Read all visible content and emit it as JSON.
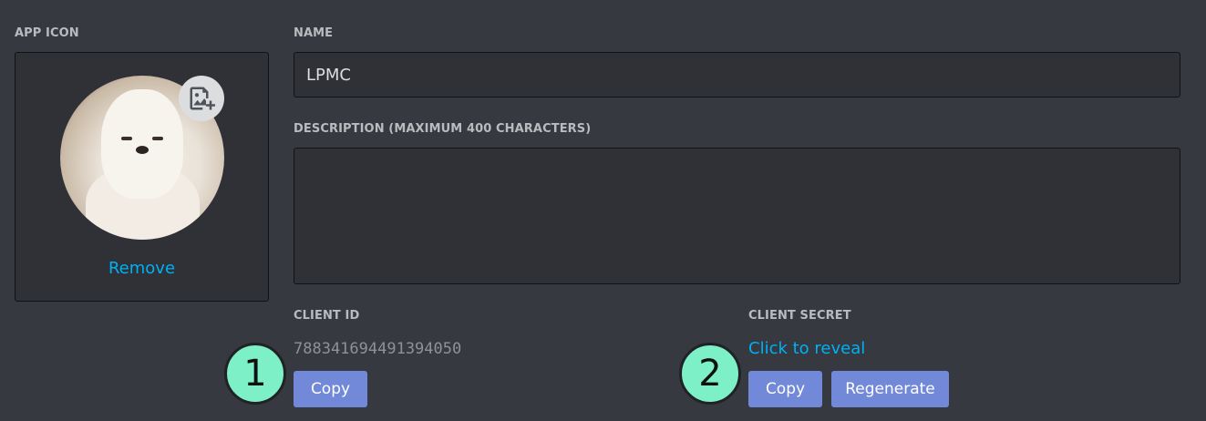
{
  "app_icon": {
    "label": "APP ICON",
    "remove_label": "Remove",
    "upload_icon": "image-plus-icon"
  },
  "name": {
    "label": "NAME",
    "value": "LPMC"
  },
  "description": {
    "label": "DESCRIPTION (MAXIMUM 400 CHARACTERS)",
    "value": ""
  },
  "client_id": {
    "label": "CLIENT ID",
    "value": "788341694491394050",
    "copy_label": "Copy"
  },
  "client_secret": {
    "label": "CLIENT SECRET",
    "reveal_label": "Click to reveal",
    "copy_label": "Copy",
    "regenerate_label": "Regenerate"
  },
  "annotations": {
    "marker_1": "1",
    "marker_2": "2"
  },
  "colors": {
    "background": "#36393f",
    "link": "#00b0f4",
    "button": "#7289da",
    "marker": "#7ef0c8"
  }
}
